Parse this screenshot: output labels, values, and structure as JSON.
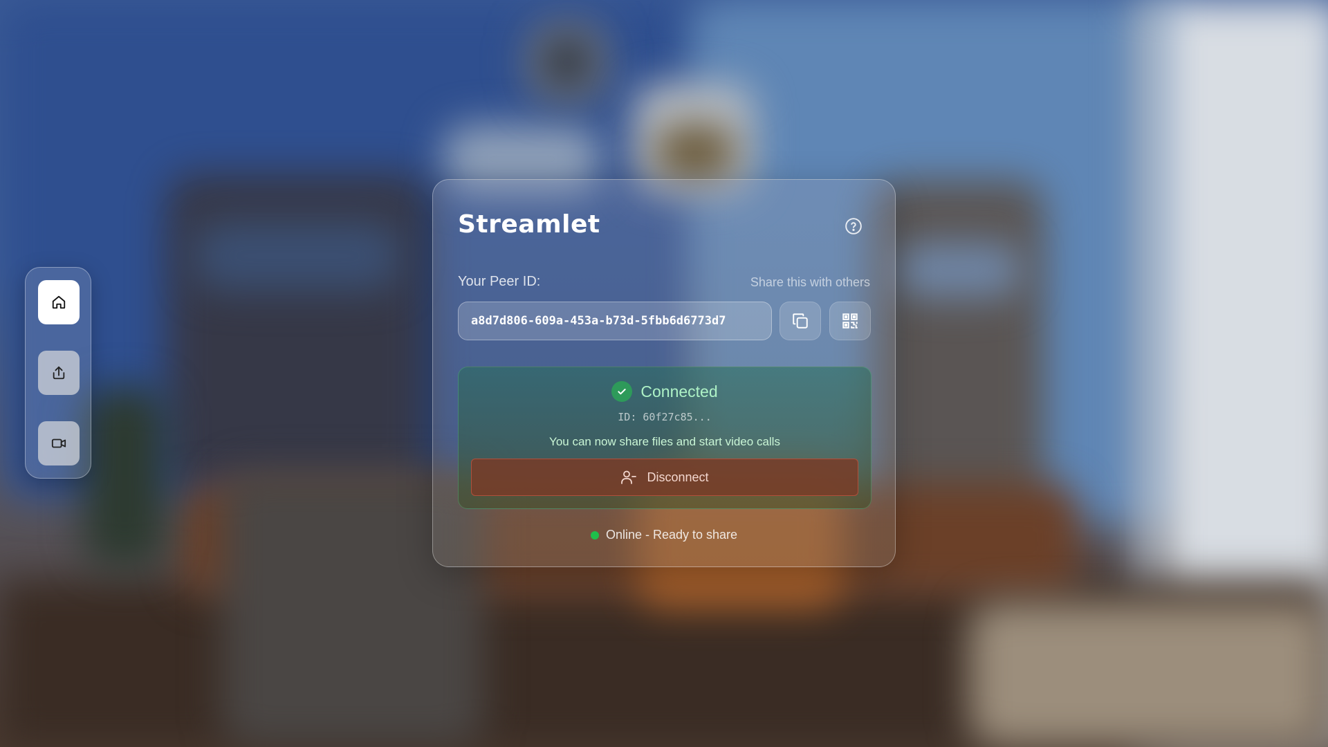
{
  "app": {
    "title": "Streamlet"
  },
  "sidebar": {
    "items": [
      {
        "name": "home",
        "icon": "home-icon",
        "active": true
      },
      {
        "name": "share",
        "icon": "share-icon",
        "active": false
      },
      {
        "name": "video",
        "icon": "video-icon",
        "active": false
      }
    ]
  },
  "peer": {
    "label": "Your Peer ID:",
    "hint": "Share this with others",
    "id_value": "a8d7d806-609a-453a-b73d-5fbb6d6773d7",
    "copy_icon": "copy-icon",
    "qr_icon": "qr-code-icon"
  },
  "connection": {
    "status": "Connected",
    "remote_id": "ID: 60f27c85...",
    "message": "You can now share files and start video calls",
    "disconnect_label": "Disconnect",
    "status_color": "#aef2c6"
  },
  "footer": {
    "online_text": "Online - Ready to share",
    "online_color": "#1fbf4b"
  }
}
